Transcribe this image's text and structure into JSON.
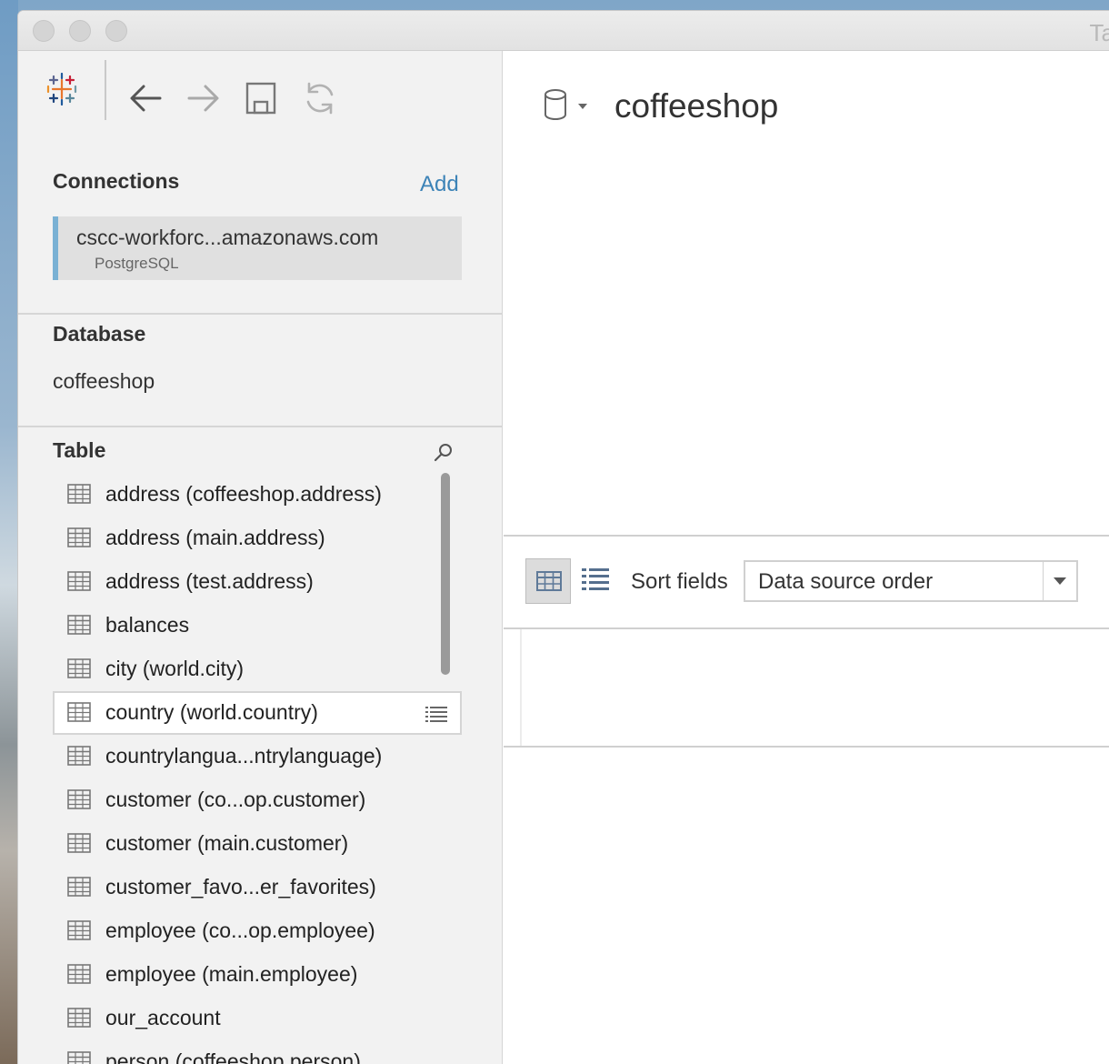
{
  "window": {
    "title_fragment": "Ta"
  },
  "toolbar": {
    "icons": [
      "tableau-logo-icon",
      "back-arrow-icon",
      "forward-arrow-icon",
      "save-icon",
      "refresh-icon"
    ]
  },
  "connections": {
    "title": "Connections",
    "add_label": "Add",
    "items": [
      {
        "name": "cscc-workforc...amazonaws.com",
        "type": "PostgreSQL"
      }
    ]
  },
  "database": {
    "title": "Database",
    "value": "coffeeshop"
  },
  "tables": {
    "title": "Table",
    "items": [
      {
        "label": "address (coffeeshop.address)"
      },
      {
        "label": "address (main.address)"
      },
      {
        "label": "address (test.address)"
      },
      {
        "label": "balances"
      },
      {
        "label": "city (world.city)"
      },
      {
        "label": "country (world.country)",
        "selected": true
      },
      {
        "label": "countrylangua...ntrylanguage)"
      },
      {
        "label": "customer (co...op.customer)"
      },
      {
        "label": "customer (main.customer)"
      },
      {
        "label": "customer_favo...er_favorites)"
      },
      {
        "label": "employee (co...op.employee)"
      },
      {
        "label": "employee (main.employee)"
      },
      {
        "label": "our_account"
      },
      {
        "label": "person (coffeeshop.person)"
      }
    ]
  },
  "datasource": {
    "name": "coffeeshop"
  },
  "fields": {
    "sort_label": "Sort fields",
    "sort_value": "Data source order"
  },
  "colors": {
    "accent": "#3c83b7",
    "connection_bar": "#7ab1d4"
  }
}
